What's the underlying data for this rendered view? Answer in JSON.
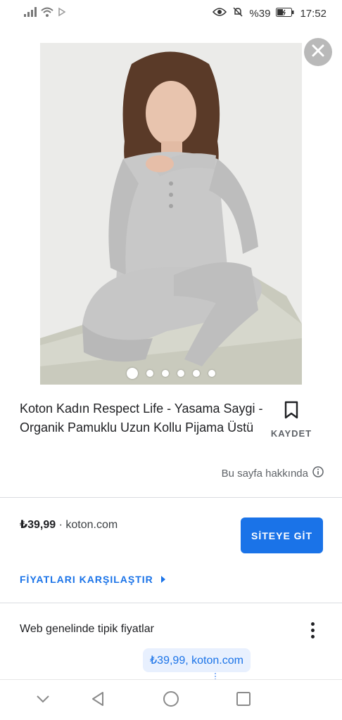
{
  "status_bar": {
    "battery_percent": "%39",
    "time": "17:52"
  },
  "image": {
    "alt_description": "product-photo",
    "carousel_total": 6,
    "carousel_active_index": 0
  },
  "product": {
    "title": "Koton Kadın Respect Life - Yasama Saygi - Organik Pamuklu Uzun Kollu Pijama Üstü",
    "save_label": "KAYDET",
    "about_label": "Bu sayfa hakkında"
  },
  "offer": {
    "price": "₺39,99",
    "separator": "·",
    "store": "koton.com",
    "visit_button": "SİTEYE GİT"
  },
  "compare": {
    "label": "FİYATLARI KARŞILAŞTIR"
  },
  "typical_prices": {
    "heading": "Web genelinde tipik fiyatlar",
    "chip": "₺39,99, koton.com"
  },
  "colors": {
    "accent": "#1a73e8",
    "chip_bg": "#e8f0fe",
    "text_secondary": "#5f6368",
    "divider": "#dadce0"
  }
}
